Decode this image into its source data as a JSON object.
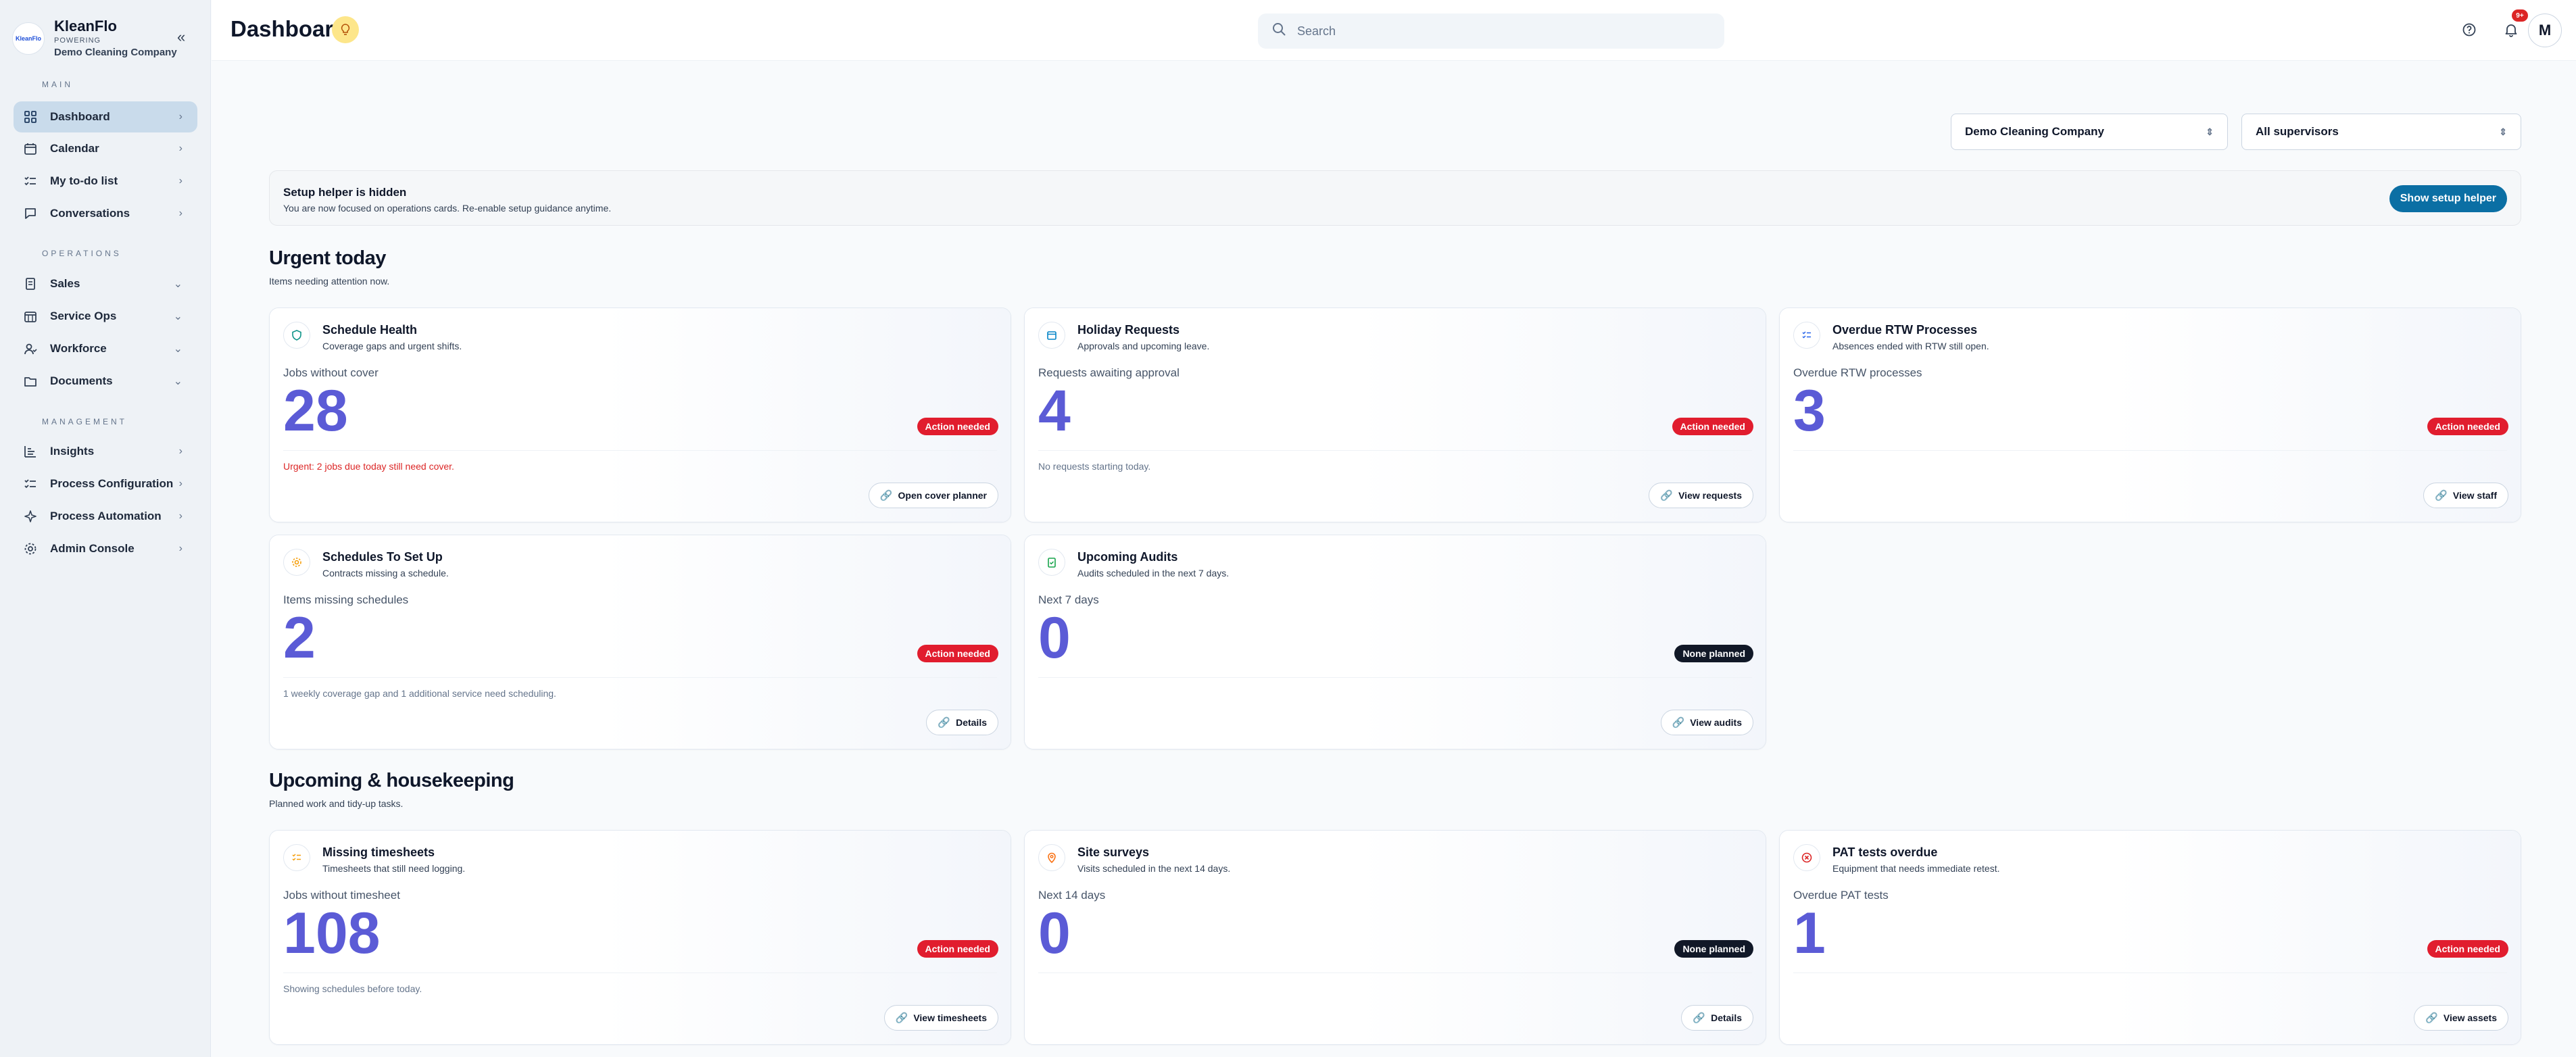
{
  "brand": {
    "logo_text": "KleanFlo",
    "name": "KleanFlo",
    "powering": "POWERING",
    "company": "Demo Cleaning Company"
  },
  "sidebar": {
    "collapse_icon": "«",
    "sections": {
      "main": "MAIN",
      "operations": "OPERATIONS",
      "management": "MANAGEMENT"
    },
    "items": [
      {
        "label": "Dashboard",
        "icon": "grid-icon",
        "chevron": "›"
      },
      {
        "label": "Calendar",
        "icon": "calendar-icon",
        "chevron": "›"
      },
      {
        "label": "My to-do list",
        "icon": "checklist-icon",
        "chevron": "›"
      },
      {
        "label": "Conversations",
        "icon": "chat-icon",
        "chevron": "›"
      },
      {
        "label": "Sales",
        "icon": "receipt-icon",
        "chevron": "⌄"
      },
      {
        "label": "Service Ops",
        "icon": "calendar-grid-icon",
        "chevron": "⌄"
      },
      {
        "label": "Workforce",
        "icon": "users-icon",
        "chevron": "⌄"
      },
      {
        "label": "Documents",
        "icon": "folder-icon",
        "chevron": "⌄"
      },
      {
        "label": "Insights",
        "icon": "bar-chart-icon",
        "chevron": "›"
      },
      {
        "label": "Process Configuration",
        "icon": "checklist-icon",
        "chevron": "›"
      },
      {
        "label": "Process Automation",
        "icon": "sparkle-icon",
        "chevron": "›"
      },
      {
        "label": "Admin Console",
        "icon": "gear-icon",
        "chevron": "›"
      }
    ]
  },
  "header": {
    "title": "Dashboard",
    "search_placeholder": "Search",
    "notification_count": "9+",
    "avatar_initial": "M"
  },
  "filters": {
    "company": "Demo Cleaning Company",
    "supervisors": "All supervisors"
  },
  "helper": {
    "title": "Setup helper is hidden",
    "subtitle": "You are now focused on operations cards. Re-enable setup guidance anytime.",
    "button": "Show setup helper"
  },
  "urgent": {
    "title": "Urgent today",
    "subtitle": "Items needing attention now.",
    "cards": [
      {
        "title": "Schedule Health",
        "subtitle": "Coverage gaps and urgent shifts.",
        "metric_label": "Jobs without cover",
        "metric": "28",
        "badge": "Action needed",
        "note": "Urgent: 2 jobs due today still need cover.",
        "button": "Open cover planner"
      },
      {
        "title": "Holiday Requests",
        "subtitle": "Approvals and upcoming leave.",
        "metric_label": "Requests awaiting approval",
        "metric": "4",
        "badge": "Action needed",
        "note": "No requests starting today.",
        "button": "View requests"
      },
      {
        "title": "Overdue RTW Processes",
        "subtitle": "Absences ended with RTW still open.",
        "metric_label": "Overdue RTW processes",
        "metric": "3",
        "badge": "Action needed",
        "note": "",
        "button": "View staff"
      },
      {
        "title": "Schedules To Set Up",
        "subtitle": "Contracts missing a schedule.",
        "metric_label": "Items missing schedules",
        "metric": "2",
        "badge": "Action needed",
        "note": "1 weekly coverage gap and 1 additional service need scheduling.",
        "button": "Details"
      },
      {
        "title": "Upcoming Audits",
        "subtitle": "Audits scheduled in the next 7 days.",
        "metric_label": "Next 7 days",
        "metric": "0",
        "badge": "None planned",
        "note": "",
        "button": "View audits"
      }
    ]
  },
  "upcoming": {
    "title": "Upcoming & housekeeping",
    "subtitle": "Planned work and tidy-up tasks.",
    "cards": [
      {
        "title": "Missing timesheets",
        "subtitle": "Timesheets that still need logging.",
        "metric_label": "Jobs without timesheet",
        "metric": "108",
        "badge": "Action needed",
        "note": "Showing schedules before today.",
        "button": "View timesheets"
      },
      {
        "title": "Site surveys",
        "subtitle": "Visits scheduled in the next 14 days.",
        "metric_label": "Next 14 days",
        "metric": "0",
        "badge": "None planned",
        "note": "",
        "button": "Details"
      },
      {
        "title": "PAT tests overdue",
        "subtitle": "Equipment that needs immediate retest.",
        "metric_label": "Overdue PAT tests",
        "metric": "1",
        "badge": "Action needed",
        "note": "",
        "button": "View assets"
      }
    ]
  },
  "colors": {
    "metric": "#5b5bd6",
    "badge_red": "#e11d2e",
    "badge_black": "#111827",
    "primary_button": "#0b6fa4",
    "active_nav": "#c9dbeb",
    "urgent_text": "#dc2626"
  }
}
